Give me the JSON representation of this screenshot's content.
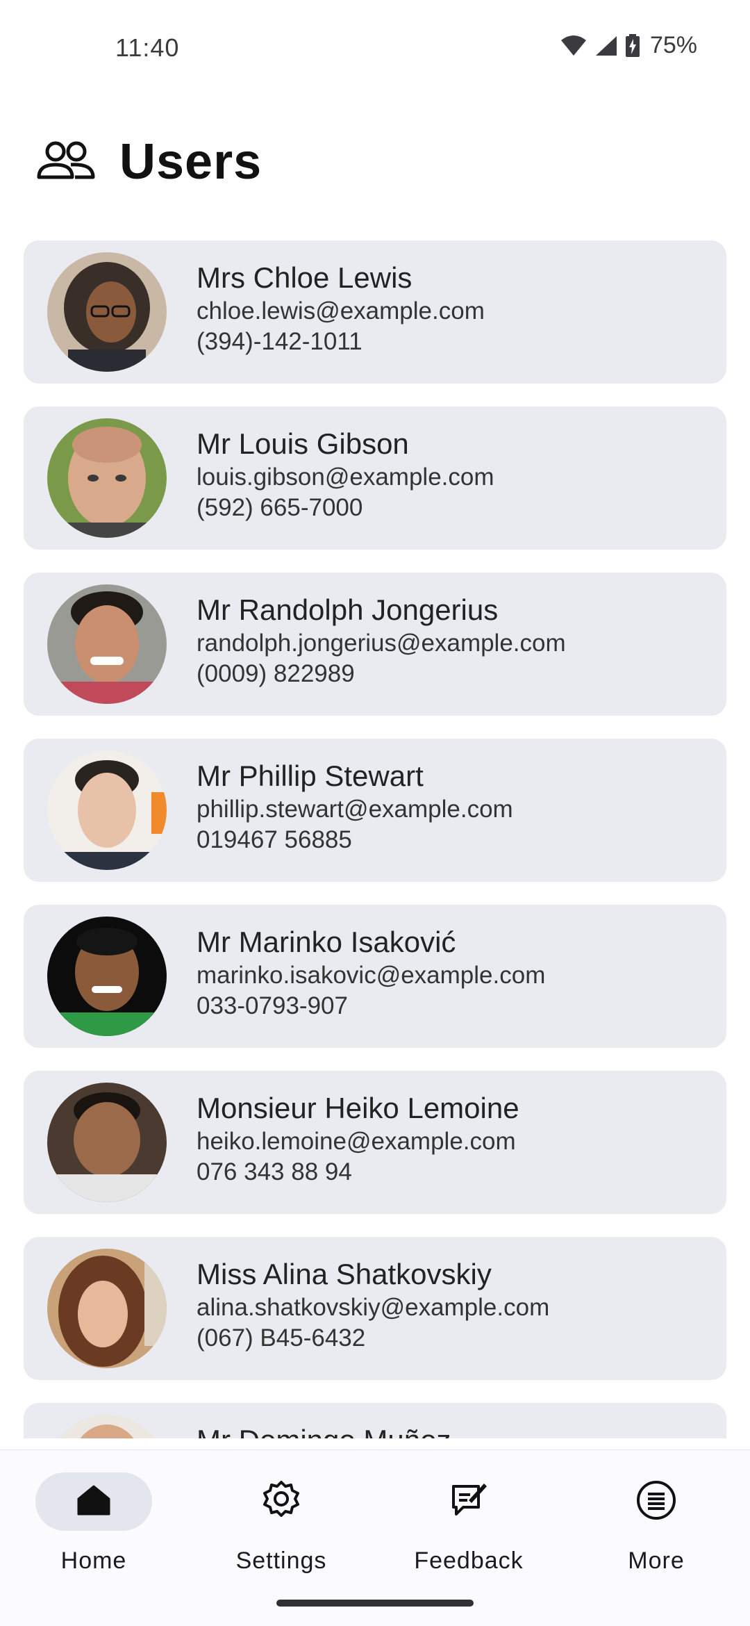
{
  "status_bar": {
    "time": "11:40",
    "battery": "75%",
    "icons": [
      "wifi-icon",
      "signal-icon",
      "battery-charging-icon"
    ]
  },
  "header": {
    "icon": "users-icon",
    "title": "Users"
  },
  "users": [
    {
      "name": "Mrs Chloe Lewis",
      "email": "chloe.lewis@example.com",
      "phone": "(394)-142-1011"
    },
    {
      "name": "Mr Louis Gibson",
      "email": "louis.gibson@example.com",
      "phone": "(592) 665-7000"
    },
    {
      "name": "Mr Randolph Jongerius",
      "email": "randolph.jongerius@example.com",
      "phone": "(0009) 822989"
    },
    {
      "name": "Mr Phillip Stewart",
      "email": "phillip.stewart@example.com",
      "phone": "019467 56885"
    },
    {
      "name": "Mr Marinko Isaković",
      "email": "marinko.isakovic@example.com",
      "phone": "033-0793-907"
    },
    {
      "name": "Monsieur Heiko Lemoine",
      "email": "heiko.lemoine@example.com",
      "phone": "076 343 88 94"
    },
    {
      "name": "Miss Alina Shatkovskiy",
      "email": "alina.shatkovskiy@example.com",
      "phone": "(067) B45-6432"
    },
    {
      "name": "Mr Domingo Muñoz",
      "email": "",
      "phone": ""
    }
  ],
  "bottom_nav": {
    "items": [
      {
        "label": "Home",
        "icon": "home-icon",
        "active": true
      },
      {
        "label": "Settings",
        "icon": "gear-icon",
        "active": false
      },
      {
        "label": "Feedback",
        "icon": "feedback-icon",
        "active": false
      },
      {
        "label": "More",
        "icon": "more-list-icon",
        "active": false
      }
    ]
  },
  "colors": {
    "card_background": "#e9ebf0",
    "active_pill": "#e4e6ee",
    "text": "#1b1b1f"
  }
}
